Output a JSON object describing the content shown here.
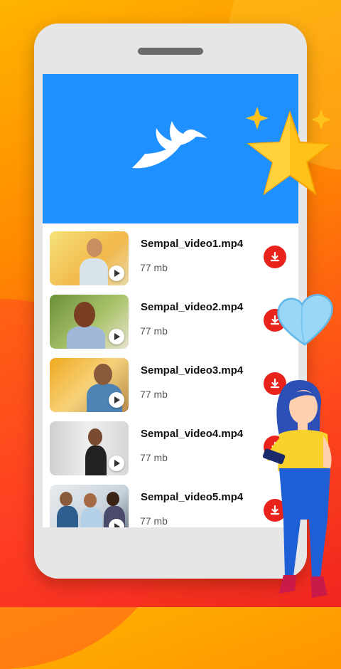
{
  "app": {
    "logo_icon": "bird-logo-icon"
  },
  "colors": {
    "accent": "#1e90ff",
    "download": "#e8231c"
  },
  "videos": [
    {
      "name": "Sempal_video1.mp4",
      "size": "77 mb"
    },
    {
      "name": "Sempal_video2.mp4",
      "size": "77 mb"
    },
    {
      "name": "Sempal_video3.mp4",
      "size": "77 mb"
    },
    {
      "name": "Sempal_video4.mp4",
      "size": "77 mb"
    },
    {
      "name": "Sempal_video5.mp4",
      "size": "77 mb"
    }
  ]
}
